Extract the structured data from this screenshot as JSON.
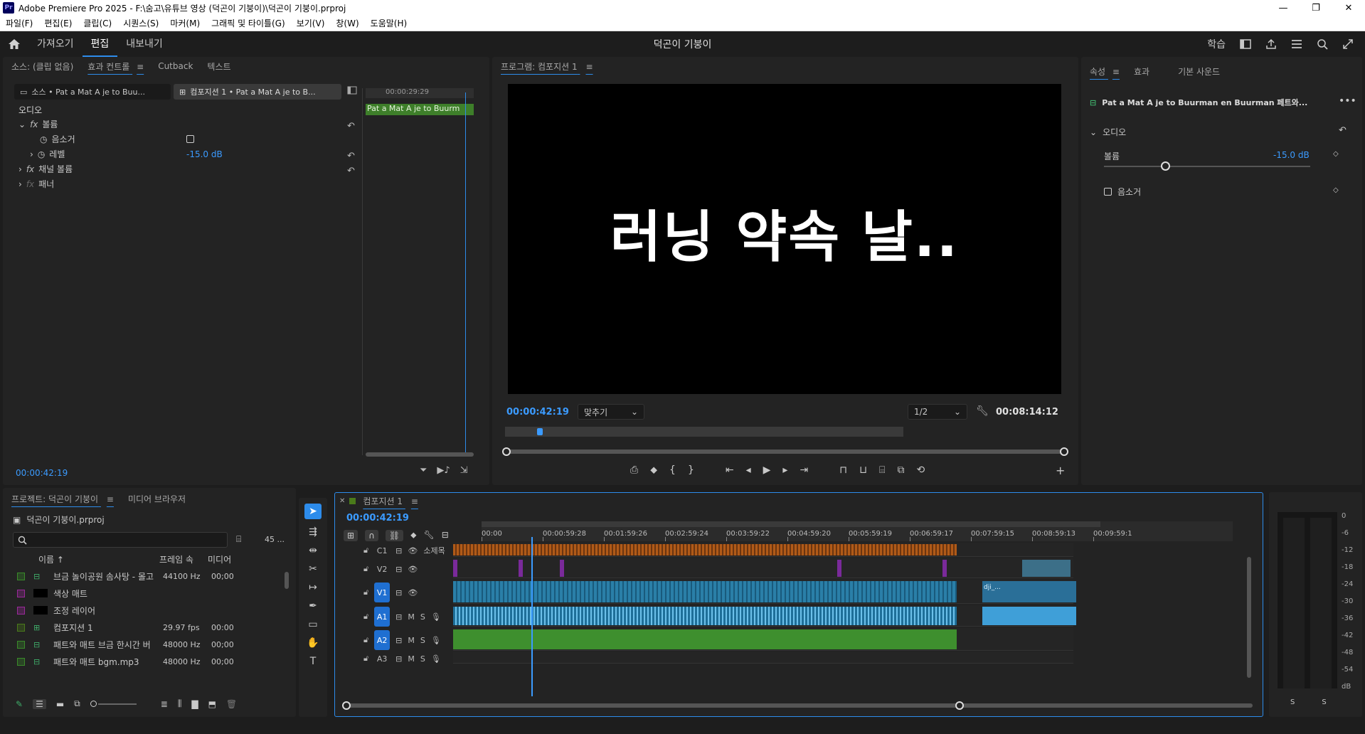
{
  "window": {
    "title": "Adobe Premiere Pro 2025 - F:\\숨고\\유튜브 영상 (덕곤이 기붕이)\\덕곤이 기붕이.prproj",
    "logo": "Pr"
  },
  "menu": [
    "파일(F)",
    "편집(E)",
    "클립(C)",
    "시퀀스(S)",
    "마커(M)",
    "그래픽 및 타이틀(G)",
    "보기(V)",
    "창(W)",
    "도움말(H)"
  ],
  "header": {
    "tabs": [
      "가져오기",
      "편집",
      "내보내기"
    ],
    "active_tab": "편집",
    "project_title": "덕곤이 기붕이",
    "learn": "학습"
  },
  "effect_controls": {
    "tabs": [
      "소스: (클립 없음)",
      "효과 컨트롤",
      "Cutback",
      "텍스트"
    ],
    "source_chip": "소스 • Pat a Mat   A je to   Buu...",
    "sequence_chip": "컴포지션 1 • Pat a Mat   A je to   B...",
    "section": "오디오",
    "rows": [
      {
        "label": "볼륨",
        "fx": true
      },
      {
        "label": "음소거",
        "indent": true
      },
      {
        "label": "레벨",
        "indent": true,
        "value": "-15.0 dB"
      },
      {
        "label": "채널 볼륨",
        "fx": true
      },
      {
        "label": "패너",
        "fx": true
      }
    ],
    "mini_timecode": "00:00:29:29",
    "mini_clip": "Pat a Mat   A je to   Buurm",
    "timecode": "00:00:42:19"
  },
  "program": {
    "tab": "프로그램: 컴포지션 1",
    "overlay_text": "러닝 약속 날..",
    "timecode": "00:00:42:19",
    "fit": "맞추기",
    "resolution": "1/2",
    "duration": "00:08:14:12",
    "playhead_fraction": 0.08
  },
  "properties": {
    "tabs": [
      "속성",
      "효과",
      "기본 사운드"
    ],
    "clip_name": "Pat a Mat   A je to   Buurman en Buurman   페트와...",
    "section": "오디오",
    "volume_label": "볼륨",
    "volume_value": "-15.0 dB",
    "mute_label": "음소거"
  },
  "project": {
    "tabs": [
      "프로젝트: 덕곤이 기붕이",
      "미디어 브라우저"
    ],
    "file": "덕곤이 기붕이.prproj",
    "count": "45 ...",
    "columns": [
      "이름",
      "프레임 속",
      "미디어"
    ],
    "items": [
      {
        "name": "브금 놀이공원 솜사탕 - 몰고",
        "rate": "44100 Hz",
        "media": "00;00",
        "color": "#3a8a2a",
        "icon": "audio-icon"
      },
      {
        "name": "색상 매트",
        "rate": "",
        "media": "",
        "color": "#9a2a9a",
        "icon": "matte-icon"
      },
      {
        "name": "조정 레이어",
        "rate": "",
        "media": "",
        "color": "#9a2a9a",
        "icon": "matte-icon"
      },
      {
        "name": "컴포지션 1",
        "rate": "29.97 fps",
        "media": "00:00",
        "color": "#4a7a1a",
        "icon": "sequence-icon"
      },
      {
        "name": "패트와 매트 브금 한시간 버",
        "rate": "48000 Hz",
        "media": "00;00",
        "color": "#3a8a2a",
        "icon": "audio-icon"
      },
      {
        "name": "패트와 매트 bgm.mp3",
        "rate": "48000 Hz",
        "media": "00;00",
        "color": "#3a8a2a",
        "icon": "audio-icon"
      }
    ]
  },
  "timeline": {
    "tab": "컴포지션 1",
    "timecode": "00:00:42:19",
    "ruler": [
      "00:00",
      "00:00:59:28",
      "00:01:59:26",
      "00:02:59:24",
      "00:03:59:22",
      "00:04:59:20",
      "00:05:59:19",
      "00:06:59:17",
      "00:07:59:15",
      "00:08:59:13",
      "00:09:59:1"
    ],
    "tracks": [
      {
        "id": "C1",
        "name": "소제목"
      },
      {
        "id": "V2",
        "name": ""
      },
      {
        "id": "V1",
        "name": ""
      },
      {
        "id": "A1",
        "name": ""
      },
      {
        "id": "A2",
        "name": ""
      },
      {
        "id": "A3",
        "name": ""
      }
    ],
    "clip_label": "dji_..."
  },
  "meter": {
    "scale": [
      "0",
      "-6",
      "-12",
      "-18",
      "-24",
      "-30",
      "-36",
      "-42",
      "-48",
      "-54",
      "dB"
    ],
    "solo": [
      "S",
      "S"
    ]
  },
  "colors": {
    "accent": "#2d8ceb",
    "video_clip": "#2a7fa8",
    "audio_clip": "#3e8f2e",
    "caption": "#b05a18",
    "purple": "#7a2a9a"
  }
}
